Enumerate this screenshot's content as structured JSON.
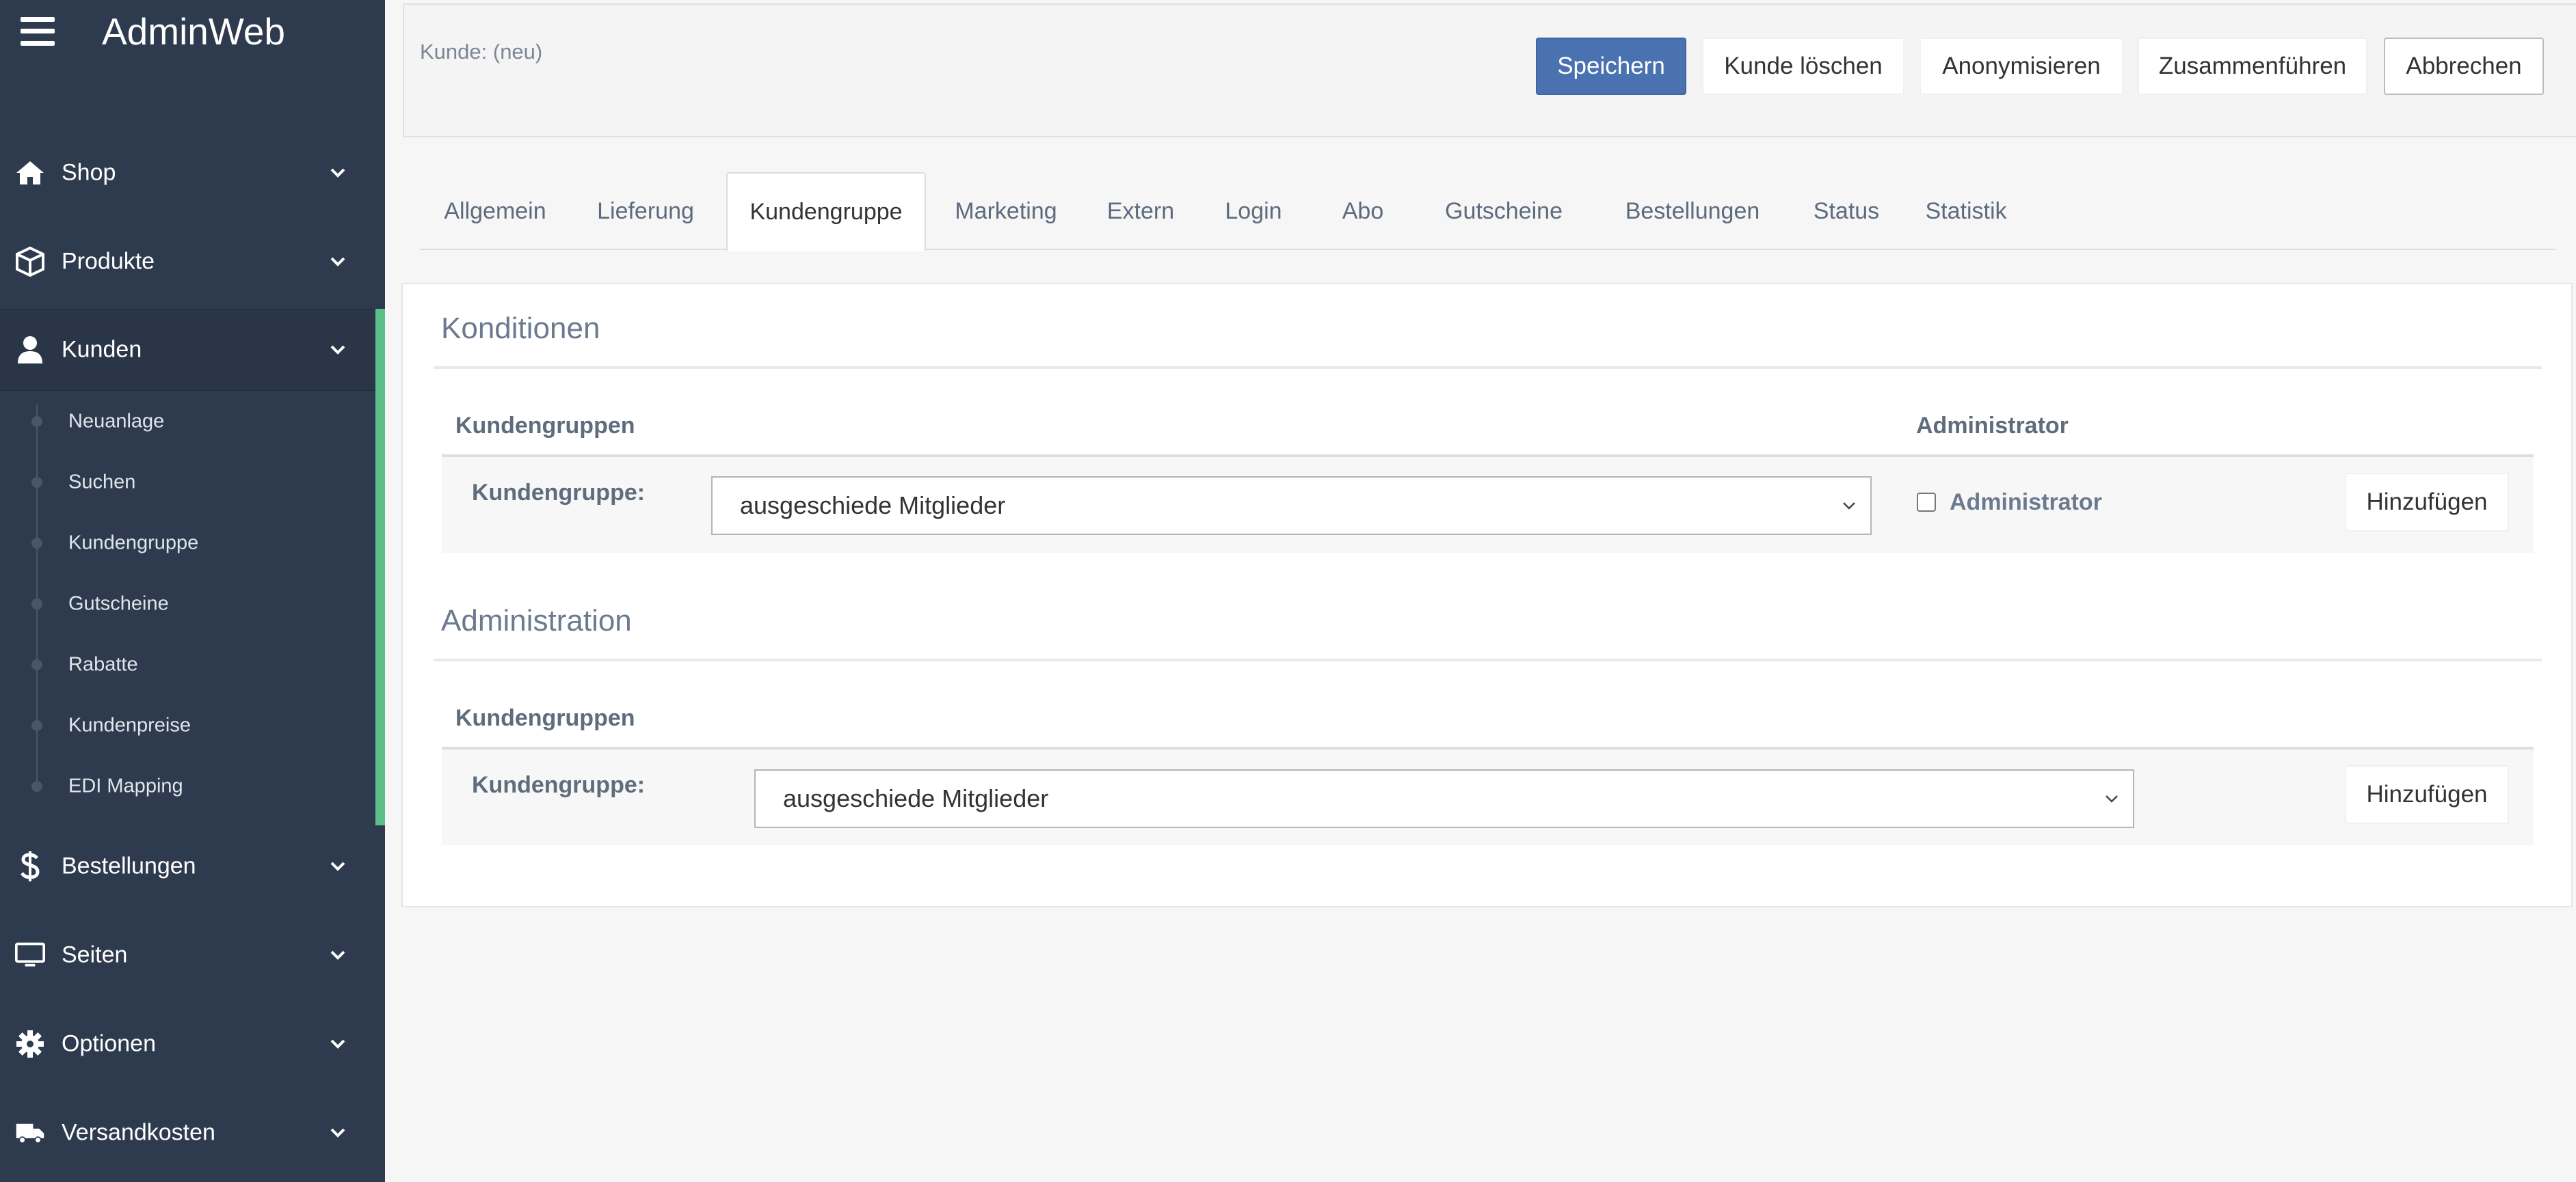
{
  "app": {
    "title": "AdminWeb"
  },
  "sidebar": {
    "items": [
      {
        "label": "Shop",
        "icon": "home-icon"
      },
      {
        "label": "Produkte",
        "icon": "box-icon"
      },
      {
        "label": "Kunden",
        "icon": "user-icon",
        "active": true
      },
      {
        "label": "Bestellungen",
        "icon": "dollar-icon"
      },
      {
        "label": "Seiten",
        "icon": "monitor-icon"
      },
      {
        "label": "Optionen",
        "icon": "gear-icon"
      },
      {
        "label": "Versandkosten",
        "icon": "truck-icon"
      }
    ],
    "sub_items": [
      "Neuanlage",
      "Suchen",
      "Kundengruppe",
      "Gutscheine",
      "Rabatte",
      "Kundenpreise",
      "EDI Mapping"
    ]
  },
  "header": {
    "crumb": "Kunde: (neu)",
    "buttons": {
      "save": "Speichern",
      "delete": "Kunde löschen",
      "anonymize": "Anonymisieren",
      "merge": "Zusammenführen",
      "cancel": "Abbrechen"
    }
  },
  "tabs": [
    "Allgemein",
    "Lieferung",
    "Kundengruppe",
    "Marketing",
    "Extern",
    "Login",
    "Abo",
    "Gutscheine",
    "Bestellungen",
    "Status",
    "Statistik"
  ],
  "active_tab": "Kundengruppe",
  "conditions": {
    "title": "Konditionen",
    "col_groups": "Kundengruppen",
    "col_admin": "Administrator",
    "field_label": "Kundengruppe:",
    "selected": "ausgeschiede Mitglieder",
    "admin_checkbox_label": "Administrator",
    "admin_checked": false,
    "add_label": "Hinzufügen"
  },
  "administration": {
    "title": "Administration",
    "col_groups": "Kundengruppen",
    "field_label": "Kundengruppe:",
    "selected": "ausgeschiede Mitglieder",
    "add_label": "Hinzufügen"
  },
  "colors": {
    "sidebar_bg": "#2e3b4e",
    "accent_active": "#5cbf8a",
    "primary_button": "#4a72b0"
  }
}
